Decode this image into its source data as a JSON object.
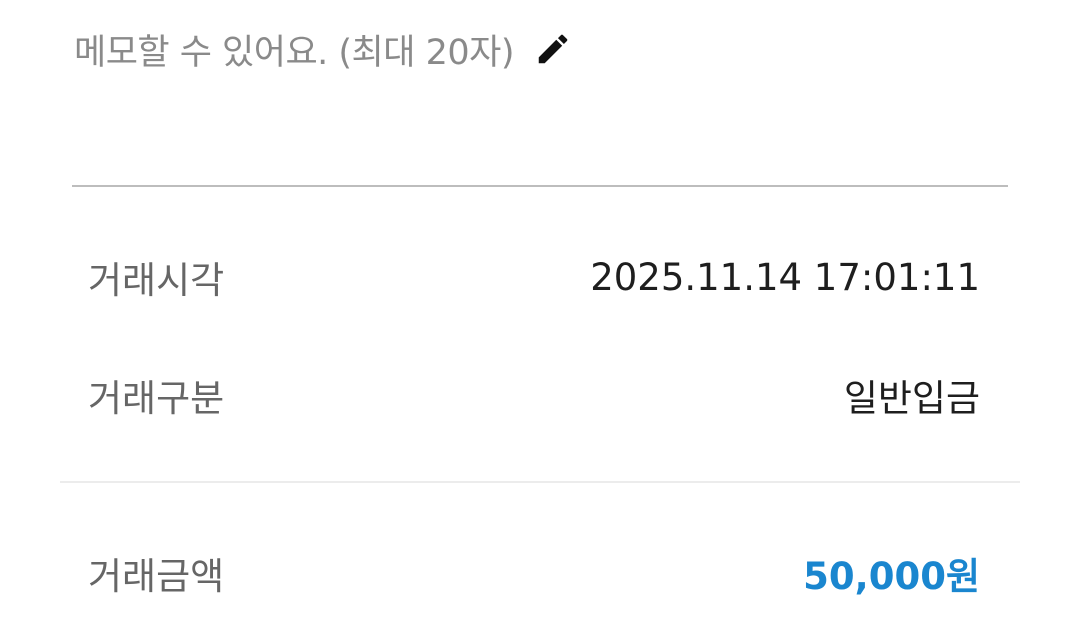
{
  "memo": {
    "placeholder": "메모할 수 있어요. (최대 20자)",
    "icon": "pencil-edit-icon"
  },
  "details": {
    "time_label": "거래시각",
    "time_value": "2025.11.14 17:01:11",
    "type_label": "거래구분",
    "type_value": "일반입금",
    "amount_label": "거래금액",
    "amount_value": "50,000원"
  },
  "colors": {
    "amount_accent": "#1a86cf",
    "placeholder_text": "#8a8a8a",
    "label_text": "#666666",
    "value_text": "#1e1e1e"
  }
}
